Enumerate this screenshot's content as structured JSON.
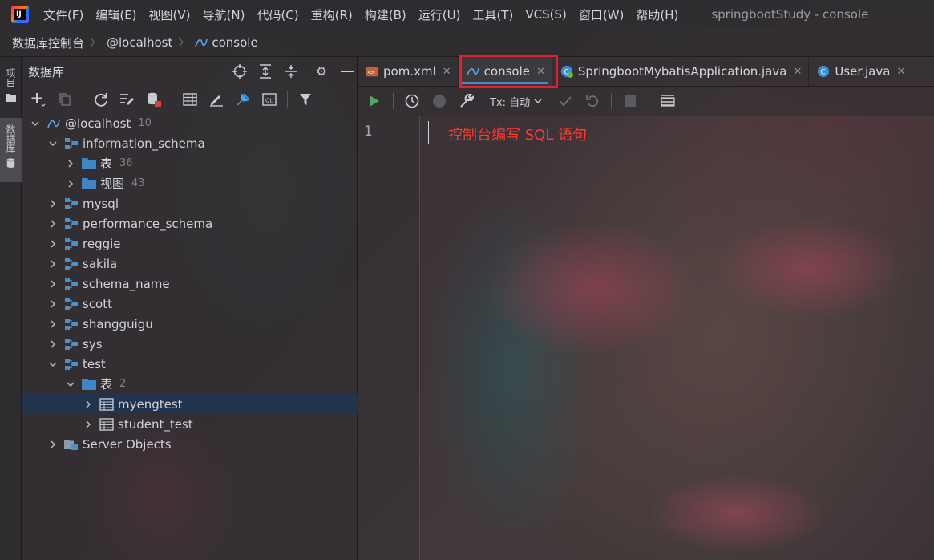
{
  "menu": {
    "items": [
      "文件(F)",
      "编辑(E)",
      "视图(V)",
      "导航(N)",
      "代码(C)",
      "重构(R)",
      "构建(B)",
      "运行(U)",
      "工具(T)",
      "VCS(S)",
      "窗口(W)",
      "帮助(H)"
    ],
    "window_title": "springbootStudy - console"
  },
  "breadcrumb": [
    "数据库控制台",
    "@localhost",
    "console"
  ],
  "stripe": {
    "project_label": "项目",
    "database_label": "数据库"
  },
  "panel": {
    "title": "数据库",
    "tree": [
      {
        "label": "@localhost",
        "count": "10",
        "level": 0,
        "expanded": true,
        "icon": "datasource-icon"
      },
      {
        "label": "information_schema",
        "count": "",
        "level": 1,
        "expanded": true,
        "icon": "schema-icon"
      },
      {
        "label": "表",
        "count": "36",
        "level": 2,
        "expanded": false,
        "icon": "folder-icon"
      },
      {
        "label": "视图",
        "count": "43",
        "level": 2,
        "expanded": false,
        "icon": "folder-icon"
      },
      {
        "label": "mysql",
        "count": "",
        "level": 1,
        "expanded": false,
        "icon": "schema-icon"
      },
      {
        "label": "performance_schema",
        "count": "",
        "level": 1,
        "expanded": false,
        "icon": "schema-icon"
      },
      {
        "label": "reggie",
        "count": "",
        "level": 1,
        "expanded": false,
        "icon": "schema-icon"
      },
      {
        "label": "sakila",
        "count": "",
        "level": 1,
        "expanded": false,
        "icon": "schema-icon"
      },
      {
        "label": "schema_name",
        "count": "",
        "level": 1,
        "expanded": false,
        "icon": "schema-icon"
      },
      {
        "label": "scott",
        "count": "",
        "level": 1,
        "expanded": false,
        "icon": "schema-icon"
      },
      {
        "label": "shangguigu",
        "count": "",
        "level": 1,
        "expanded": false,
        "icon": "schema-icon"
      },
      {
        "label": "sys",
        "count": "",
        "level": 1,
        "expanded": false,
        "icon": "schema-icon"
      },
      {
        "label": "test",
        "count": "",
        "level": 1,
        "expanded": true,
        "icon": "schema-icon"
      },
      {
        "label": "表",
        "count": "2",
        "level": 2,
        "expanded": true,
        "icon": "folder-icon"
      },
      {
        "label": "myengtest",
        "count": "",
        "level": 3,
        "expanded": false,
        "icon": "table-icon",
        "selected": true
      },
      {
        "label": "student_test",
        "count": "",
        "level": 3,
        "expanded": false,
        "icon": "table-icon"
      },
      {
        "label": "Server Objects",
        "count": "",
        "level": 1,
        "expanded": false,
        "icon": "server-objects-icon"
      }
    ]
  },
  "tabs": [
    {
      "label": "pom.xml",
      "icon": "maven-icon",
      "active": false
    },
    {
      "label": "console",
      "icon": "console-icon",
      "active": true
    },
    {
      "label": "SpringbootMybatisApplication.java",
      "icon": "spring-class-icon",
      "active": false
    },
    {
      "label": "User.java",
      "icon": "class-icon",
      "active": false
    }
  ],
  "console_toolbar": {
    "tx_label": "Tx: 自动"
  },
  "editor": {
    "line_number": "1",
    "annotation": "控制台编写 SQL 语句"
  },
  "colors": {
    "accent": "#4a88c7",
    "highlight": "#e5202a",
    "annotation": "#ff3b30",
    "selection": "#213450"
  }
}
